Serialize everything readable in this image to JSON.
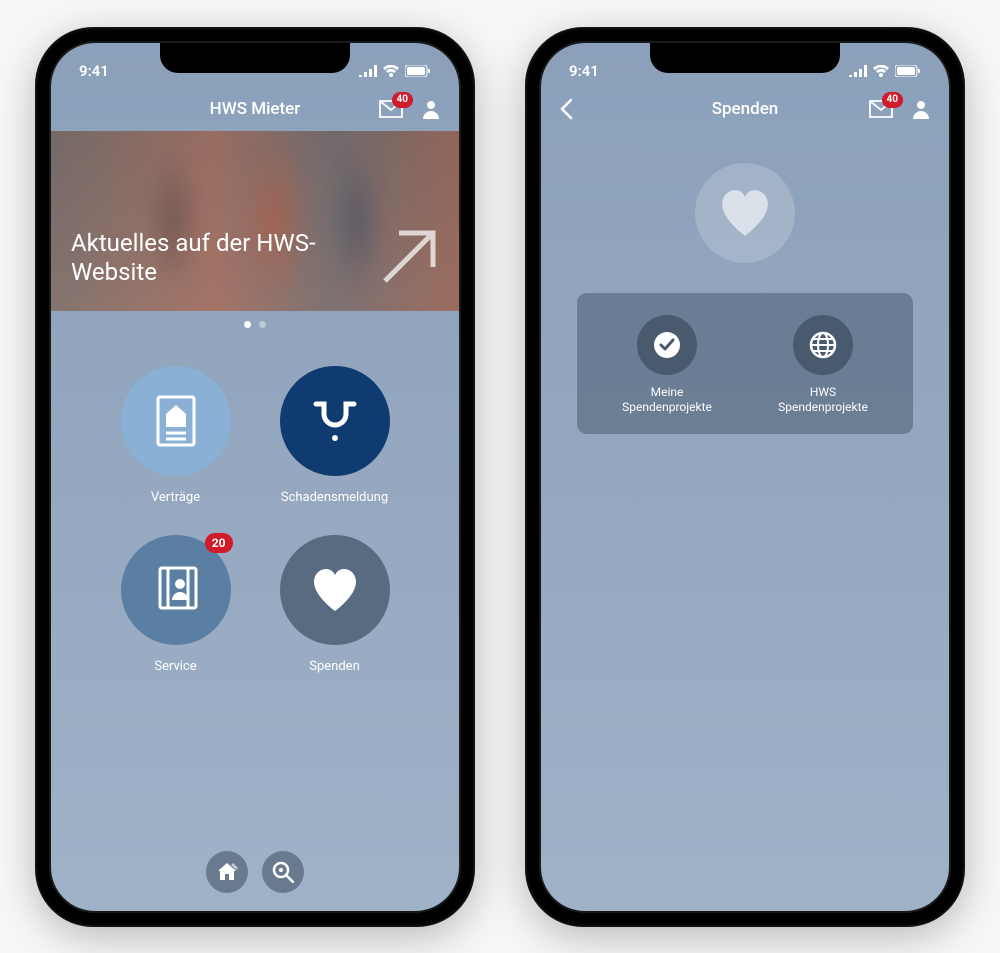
{
  "status": {
    "time": "9:41"
  },
  "screen1": {
    "title": "HWS Mieter",
    "mail_badge": "40",
    "hero_text": "Aktuelles auf der HWS-Website",
    "tiles": [
      {
        "label": "Verträge",
        "color": "#8bb0d6",
        "icon": "document-house-icon",
        "badge": ""
      },
      {
        "label": "Schadensmeldung",
        "color": "#0f3b70",
        "icon": "pipe-leak-icon",
        "badge": ""
      },
      {
        "label": "Service",
        "color": "#5a7fa3",
        "icon": "document-person-icon",
        "badge": "20"
      },
      {
        "label": "Spenden",
        "color": "#596b80",
        "icon": "heart-icon",
        "badge": ""
      }
    ]
  },
  "screen2": {
    "title": "Spenden",
    "mail_badge": "40",
    "items": [
      {
        "label": "Meine\nSpendenprojekte",
        "icon": "check-icon"
      },
      {
        "label": "HWS\nSpendenprojekte",
        "icon": "globe-icon"
      }
    ]
  }
}
